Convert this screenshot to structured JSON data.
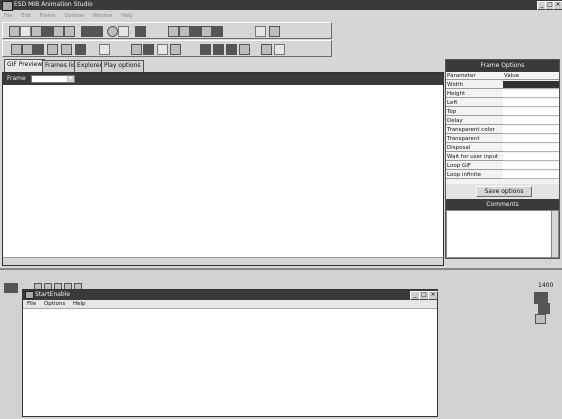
{
  "app": {
    "title": "ESD MIB Animation Studio",
    "window_buttons": [
      "_",
      "□",
      "×"
    ]
  },
  "menu": {
    "items": [
      "File",
      "Edit",
      "Frame",
      "Options",
      "Window",
      "Help"
    ]
  },
  "tabs": [
    {
      "label": "GIF Preview",
      "active": true
    },
    {
      "label": "Frames list",
      "active": false
    },
    {
      "label": "Explorer",
      "active": false
    },
    {
      "label": "Play options",
      "active": false
    }
  ],
  "preview": {
    "frame_label": "Frame"
  },
  "frame_options": {
    "title": "Frame Options",
    "col_parameter": "Parameter",
    "col_value": "Value",
    "parameters": [
      "Width",
      "Height",
      "Left",
      "Top",
      "Delay",
      "Transparent color",
      "Transparent",
      "Disposal",
      "Wait for user input",
      "Loop GIF",
      "Loop infinite"
    ],
    "save_button": "Save options"
  },
  "comments": {
    "title": "Comments"
  },
  "child_window": {
    "title": "StartEnable",
    "menu": [
      "File",
      "Options",
      "Help"
    ]
  },
  "side_counter": "1400",
  "colors": {
    "titlebar": "#3a3a3a",
    "face": "#d6d6d6",
    "workspace": "#ffffff"
  }
}
